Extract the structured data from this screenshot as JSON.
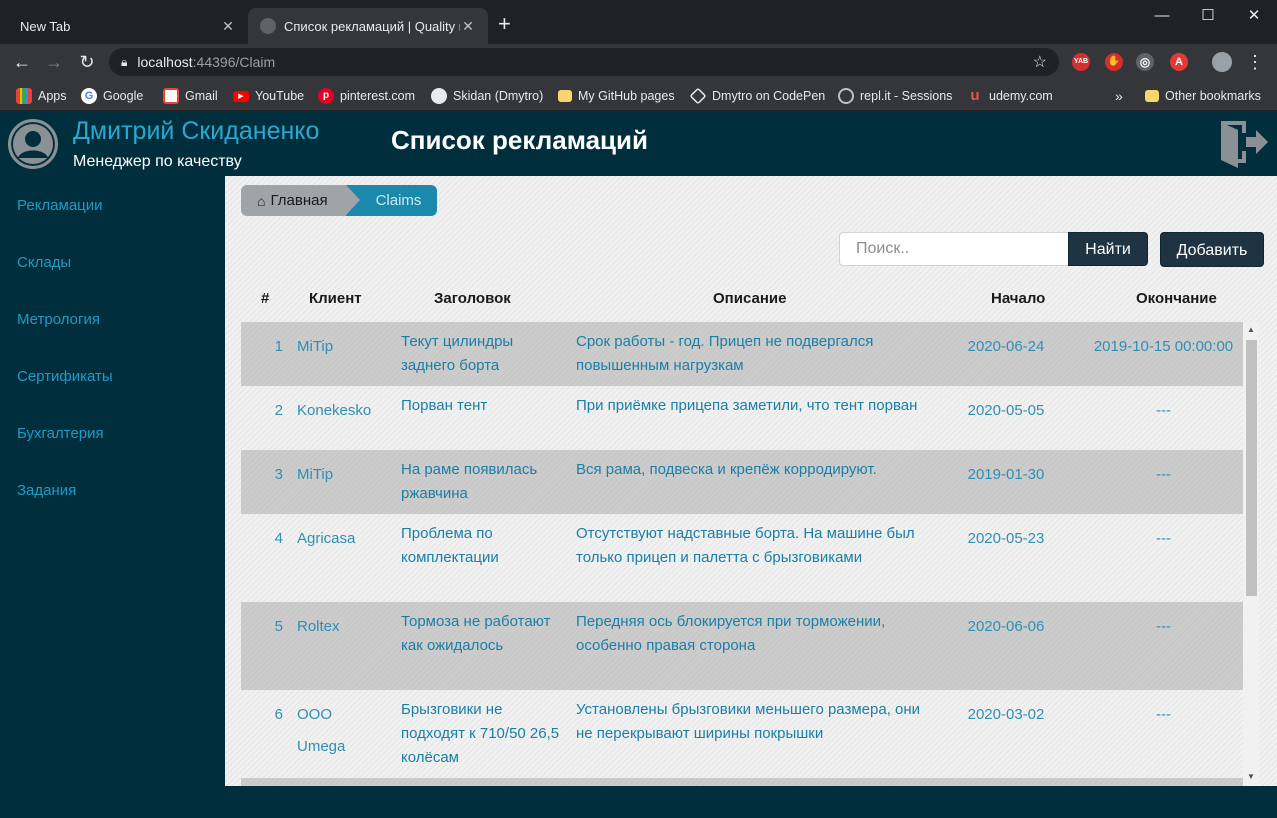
{
  "browser": {
    "tabs": [
      {
        "title": "New Tab"
      },
      {
        "title": "Список рекламаций | Quality ma"
      }
    ],
    "url_host": "localhost",
    "url_rest": ":44396/Claim",
    "bookmarks": [
      {
        "label": "Apps",
        "icon": "apps-grid-icon"
      },
      {
        "label": "Google",
        "icon": "google-icon"
      },
      {
        "label": "Gmail",
        "icon": "gmail-icon"
      },
      {
        "label": "YouTube",
        "icon": "youtube-icon"
      },
      {
        "label": "pinterest.com",
        "icon": "pinterest-icon"
      },
      {
        "label": "Skidan (Dmytro)",
        "icon": "github-icon"
      },
      {
        "label": "My GitHub pages",
        "icon": "folder-icon"
      },
      {
        "label": "Dmytro on CodePen",
        "icon": "codepen-icon"
      },
      {
        "label": "repl.it - Sessions",
        "icon": "replit-icon"
      },
      {
        "label": "udemy.com",
        "icon": "udemy-icon"
      }
    ],
    "more_bookmarks": "»",
    "other_bookmarks": "Other bookmarks",
    "extensions": [
      {
        "label": "YAB",
        "color": "#d32f2f"
      },
      {
        "label": "✋",
        "color": "#d32f2f"
      },
      {
        "label": "◎",
        "color": "#5f6368"
      },
      {
        "label": "A",
        "color": "#e53935"
      }
    ]
  },
  "app": {
    "user_name": "Дмитрий Скиданенко",
    "user_role": "Менеджер по качеству",
    "page_title": "Список рекламаций",
    "sidebar": [
      {
        "label": "Рекламации"
      },
      {
        "label": "Склады"
      },
      {
        "label": "Метрология"
      },
      {
        "label": "Сертификаты"
      },
      {
        "label": "Бухгалтерия"
      },
      {
        "label": "Задания"
      }
    ],
    "breadcrumb": {
      "home": "Главная",
      "current": "Claims"
    },
    "search": {
      "placeholder": "Поиск..",
      "button": "Найти"
    },
    "add_button": "Добавить",
    "table": {
      "headers": {
        "num": "#",
        "client": "Клиент",
        "title": "Заголовок",
        "description": "Описание",
        "start": "Начало",
        "end": "Окончание"
      },
      "rows": [
        {
          "num": "1",
          "client": "MiTip",
          "title": "Текут цилиндры заднего борта",
          "description": "Срок работы - год. Прицеп не подвергался повышенным нагрузкам",
          "start": "2020-06-24",
          "end": "2019-10-15 00:00:00"
        },
        {
          "num": "2",
          "client": "Konekesko",
          "title": "Порван тент",
          "description": "При приёмке прицепа заметили, что тент порван",
          "start": "2020-05-05",
          "end": "---"
        },
        {
          "num": "3",
          "client": "MiTip",
          "title": "На раме появилась ржавчина",
          "description": "Вся рама, подвеска и крепёж корродируют.",
          "start": "2019-01-30",
          "end": "---"
        },
        {
          "num": "4",
          "client": "Agricasa",
          "title": "Проблема по комплектации",
          "description": "Отсутствуют надставные борта. На машине был только прицеп и палетта с брызговиками",
          "start": "2020-05-23",
          "end": "---"
        },
        {
          "num": "5",
          "client": "Roltex",
          "title": "Тормоза не работают как ожидалось",
          "description": "Передняя ось блокируется при торможении, особенно правая сторона",
          "start": "2020-06-06",
          "end": "---"
        },
        {
          "num": "6",
          "client": "ООО Umega",
          "title": "Брызговики не подходят к 710/50 26,5 колёсам",
          "description": "Установлены брызговики меньшего размера, они не перекрывают ширины покрышки",
          "start": "2020-03-02",
          "end": "---"
        }
      ]
    }
  }
}
